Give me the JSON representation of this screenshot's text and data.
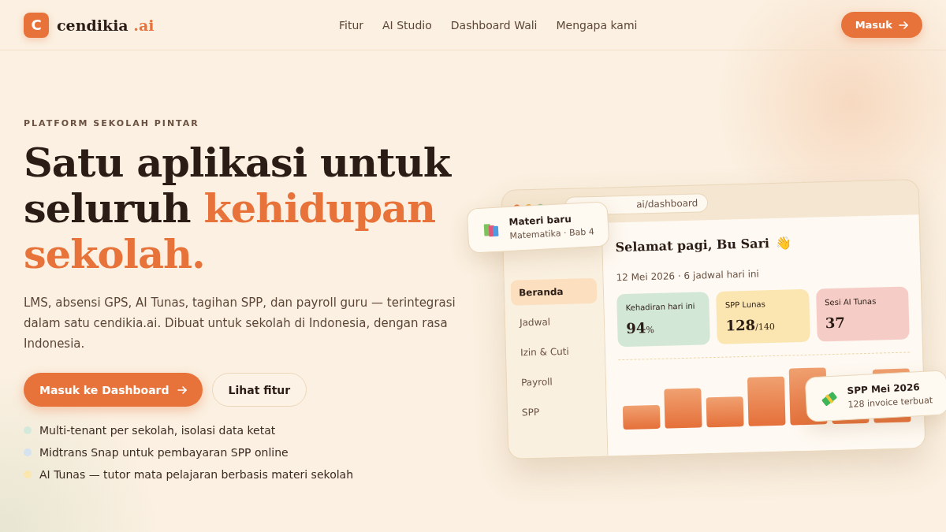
{
  "brand": {
    "mark": "C",
    "name": "cendikia",
    "suffix": ".ai"
  },
  "nav": [
    {
      "label": "Fitur"
    },
    {
      "label": "AI Studio"
    },
    {
      "label": "Dashboard Wali"
    },
    {
      "label": "Mengapa kami"
    }
  ],
  "login_button": {
    "label": "Masuk"
  },
  "hero": {
    "eyebrow": "PLATFORM SEKOLAH PINTAR",
    "title_lines": [
      {
        "text": "Satu aplikasi untuk",
        "accent": false
      },
      {
        "text": "seluruh ",
        "accent": false,
        "accent_text": "kehidupan"
      },
      {
        "text": "sekolah.",
        "accent": true
      }
    ],
    "description": "LMS, absensi GPS, AI Tunas, tagihan SPP, dan payroll guru — terintegrasi dalam satu cendikia.ai. Dibuat untuk sekolah di Indonesia, dengan rasa Indonesia.",
    "buttons": [
      {
        "kind": "primary",
        "label": "Masuk ke Dashboard"
      },
      {
        "kind": "secondary",
        "label": "Lihat fitur"
      }
    ],
    "features": [
      {
        "text": "Multi-tenant per sekolah, isolasi data ketat",
        "color": "#d3eadb"
      },
      {
        "text": "Midtrans Snap untuk pembayaran SPP online",
        "color": "#d5e2ef"
      },
      {
        "text": "AI Tunas — tutor mata pelajaran berbasis materi sekolah",
        "color": "#fbe6ad"
      }
    ]
  },
  "mockup": {
    "address": "ai/dashboard",
    "sidebar": [
      {
        "label": "Beranda",
        "selected": true
      },
      {
        "label": "Jadwal",
        "selected": false
      },
      {
        "label": "Izin & Cuti",
        "selected": false
      },
      {
        "label": "Payroll",
        "selected": false
      },
      {
        "label": "SPP",
        "selected": false
      }
    ],
    "greeting": "Selamat pagi, Bu Sari",
    "wave": "👋",
    "subtitle": "12 Mei 2026 · 6 jadwal hari ini",
    "stats": [
      {
        "label": "Kehadiran hari ini",
        "value": "94",
        "unit": "%",
        "color": "#d2e7d6"
      },
      {
        "label": "SPP Lunas",
        "value": "128",
        "unit": "/140",
        "color": "#fbe6b1"
      },
      {
        "label": "Sesi AI Tunas",
        "value": "37",
        "color": "#f5cdc6"
      }
    ]
  },
  "toasts": [
    {
      "kind": "books",
      "title": "Materi baru",
      "subtitle": "Matematika · Bab 4"
    },
    {
      "kind": "money",
      "title": "SPP Mei 2026",
      "subtitle": "128 invoice terbuat"
    }
  ]
}
